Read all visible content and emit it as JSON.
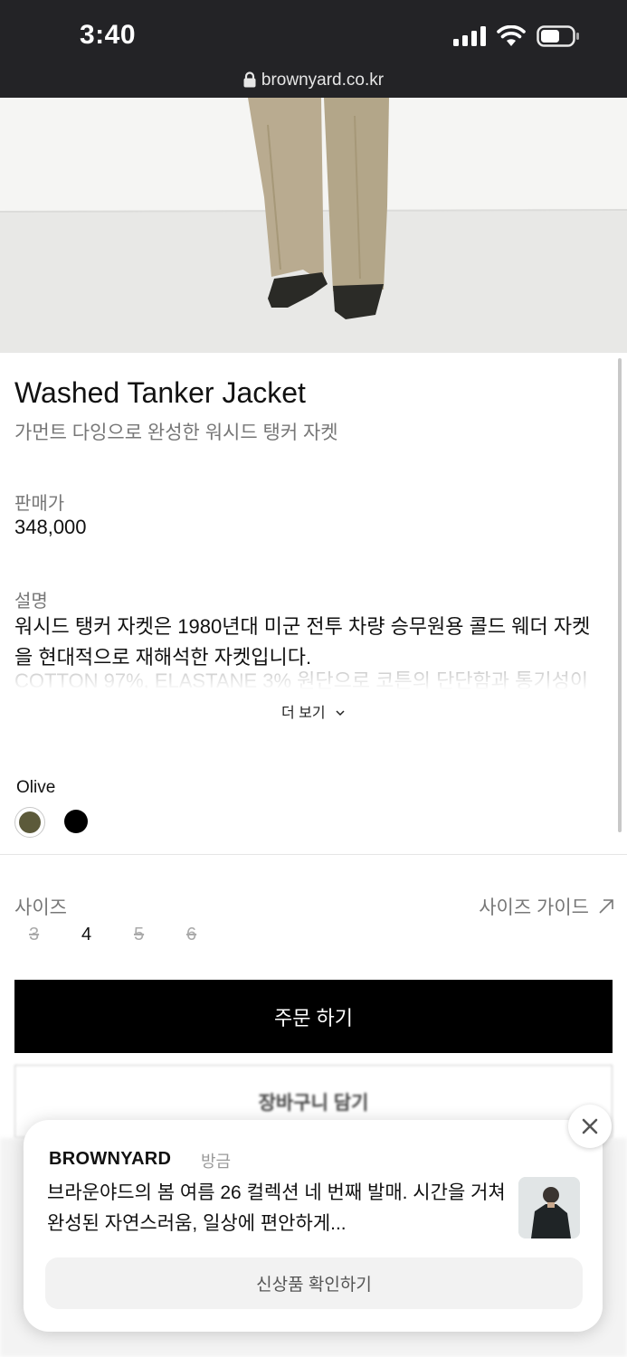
{
  "status_bar": {
    "time": "3:40",
    "url": "brownyard.co.kr"
  },
  "product": {
    "title": "Washed Tanker Jacket",
    "subtitle": "가먼트 다잉으로 완성한 워시드 탱커 자켓",
    "price_label": "판매가",
    "price": "348,000",
    "description_label": "설명",
    "description": "워시드 탱커 자켓은 1980년대 미군 전투 차량 승무원용 콜드 웨더 자켓을 현대적으로 재해석한 자켓입니다.",
    "description_faded": "COTTON 97%, ELASTANE 3% 원단으로 코튼의 단단함과 통기성이",
    "more_label": "더 보기",
    "color_name": "Olive",
    "colors": [
      "#5c5a3a",
      "#000000"
    ],
    "size_label": "사이즈",
    "size_guide_label": "사이즈 가이드",
    "sizes": [
      {
        "label": "3",
        "available": false
      },
      {
        "label": "4",
        "available": true
      },
      {
        "label": "5",
        "available": false
      },
      {
        "label": "6",
        "available": false
      }
    ],
    "order_button": "주문 하기",
    "cart_button": "장바구니 담기"
  },
  "notification": {
    "brand": "BROWNYARD",
    "time": "방금",
    "body": "브라운야드의 봄 여름 26 컬렉션 네 번째 발매. 시간을 거쳐 완성된 자연스러움, 일상에 편안하게...",
    "cta": "신상품 확인하기"
  }
}
